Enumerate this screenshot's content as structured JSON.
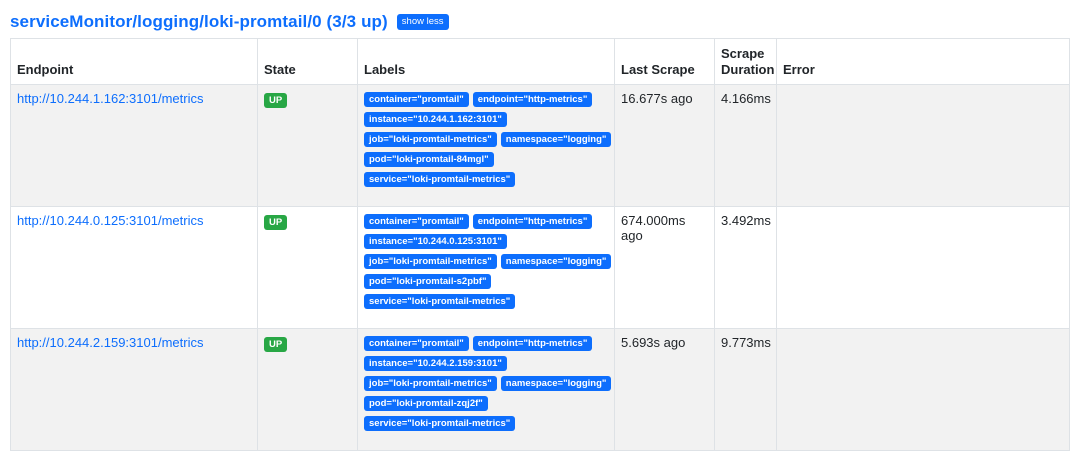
{
  "header": {
    "title": "serviceMonitor/logging/loki-promtail/0 (3/3 up)",
    "toggle_label": "show less"
  },
  "columns": {
    "endpoint": "Endpoint",
    "state": "State",
    "labels": "Labels",
    "last_scrape": "Last Scrape",
    "scrape_duration": "Scrape Duration",
    "error": "Error"
  },
  "rows": [
    {
      "endpoint": "http://10.244.1.162:3101/metrics",
      "state": "UP",
      "labels": [
        "container=\"promtail\"",
        "endpoint=\"http-metrics\"",
        "instance=\"10.244.1.162:3101\"",
        "job=\"loki-promtail-metrics\"",
        "namespace=\"logging\"",
        "pod=\"loki-promtail-84mgl\"",
        "service=\"loki-promtail-metrics\""
      ],
      "last_scrape": "16.677s ago",
      "scrape_duration": "4.166ms",
      "error": ""
    },
    {
      "endpoint": "http://10.244.0.125:3101/metrics",
      "state": "UP",
      "labels": [
        "container=\"promtail\"",
        "endpoint=\"http-metrics\"",
        "instance=\"10.244.0.125:3101\"",
        "job=\"loki-promtail-metrics\"",
        "namespace=\"logging\"",
        "pod=\"loki-promtail-s2pbf\"",
        "service=\"loki-promtail-metrics\""
      ],
      "last_scrape": "674.000ms ago",
      "scrape_duration": "3.492ms",
      "error": ""
    },
    {
      "endpoint": "http://10.244.2.159:3101/metrics",
      "state": "UP",
      "labels": [
        "container=\"promtail\"",
        "endpoint=\"http-metrics\"",
        "instance=\"10.244.2.159:3101\"",
        "job=\"loki-promtail-metrics\"",
        "namespace=\"logging\"",
        "pod=\"loki-promtail-zqj2f\"",
        "service=\"loki-promtail-metrics\""
      ],
      "last_scrape": "5.693s ago",
      "scrape_duration": "9.773ms",
      "error": ""
    }
  ],
  "colors": {
    "link": "#0d6efd",
    "badge_blue": "#0d6efd",
    "badge_green": "#28a745",
    "row_shade": "#f2f2f2"
  }
}
